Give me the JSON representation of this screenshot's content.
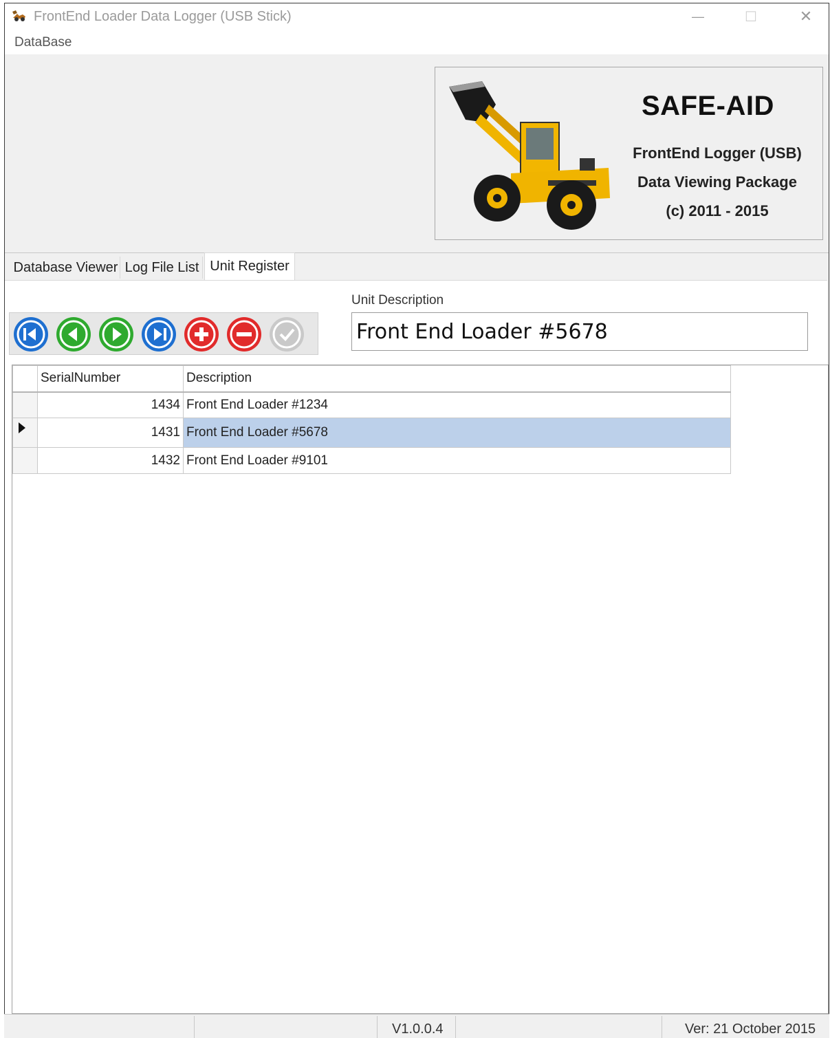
{
  "window": {
    "title": "FrontEnd Loader Data Logger (USB Stick)",
    "minimize_glyph": "—",
    "maximize_glyph": "☐",
    "close_glyph": "✕"
  },
  "menu": {
    "items": [
      {
        "label": "DataBase"
      }
    ]
  },
  "banner": {
    "brand": "SAFE-AID",
    "line1": "FrontEnd Logger (USB)",
    "line2": "Data Viewing Package",
    "line3": "(c) 2011 - 2015",
    "image": "front-end-loader-image"
  },
  "tabs": [
    {
      "label": "Database Viewer",
      "active": false
    },
    {
      "label": "Log File List",
      "active": false
    },
    {
      "label": "Unit Register",
      "active": true
    }
  ],
  "toolbar": {
    "buttons": [
      {
        "name": "first-record-icon",
        "color": "#1e6fd0"
      },
      {
        "name": "previous-record-icon",
        "color": "#2faa2f"
      },
      {
        "name": "next-record-icon",
        "color": "#2faa2f"
      },
      {
        "name": "last-record-icon",
        "color": "#1e6fd0"
      },
      {
        "name": "add-record-icon",
        "color": "#e12b2b"
      },
      {
        "name": "delete-record-icon",
        "color": "#e12b2b"
      },
      {
        "name": "save-record-icon",
        "color": "#bdbdbd"
      }
    ]
  },
  "unit_description": {
    "label": "Unit Description",
    "value": "Front End Loader #5678"
  },
  "grid": {
    "columns": [
      "SerialNumber",
      "Description"
    ],
    "rows": [
      {
        "serial": "1434",
        "description": "Front End Loader #1234",
        "current": false
      },
      {
        "serial": "1431",
        "description": "Front End Loader #5678",
        "current": true
      },
      {
        "serial": "1432",
        "description": "Front End Loader #9101",
        "current": false
      }
    ],
    "selection_color": "#bcd0ea"
  },
  "status": {
    "version": "V1.0.0.4",
    "date": "Ver: 21 October 2015"
  }
}
